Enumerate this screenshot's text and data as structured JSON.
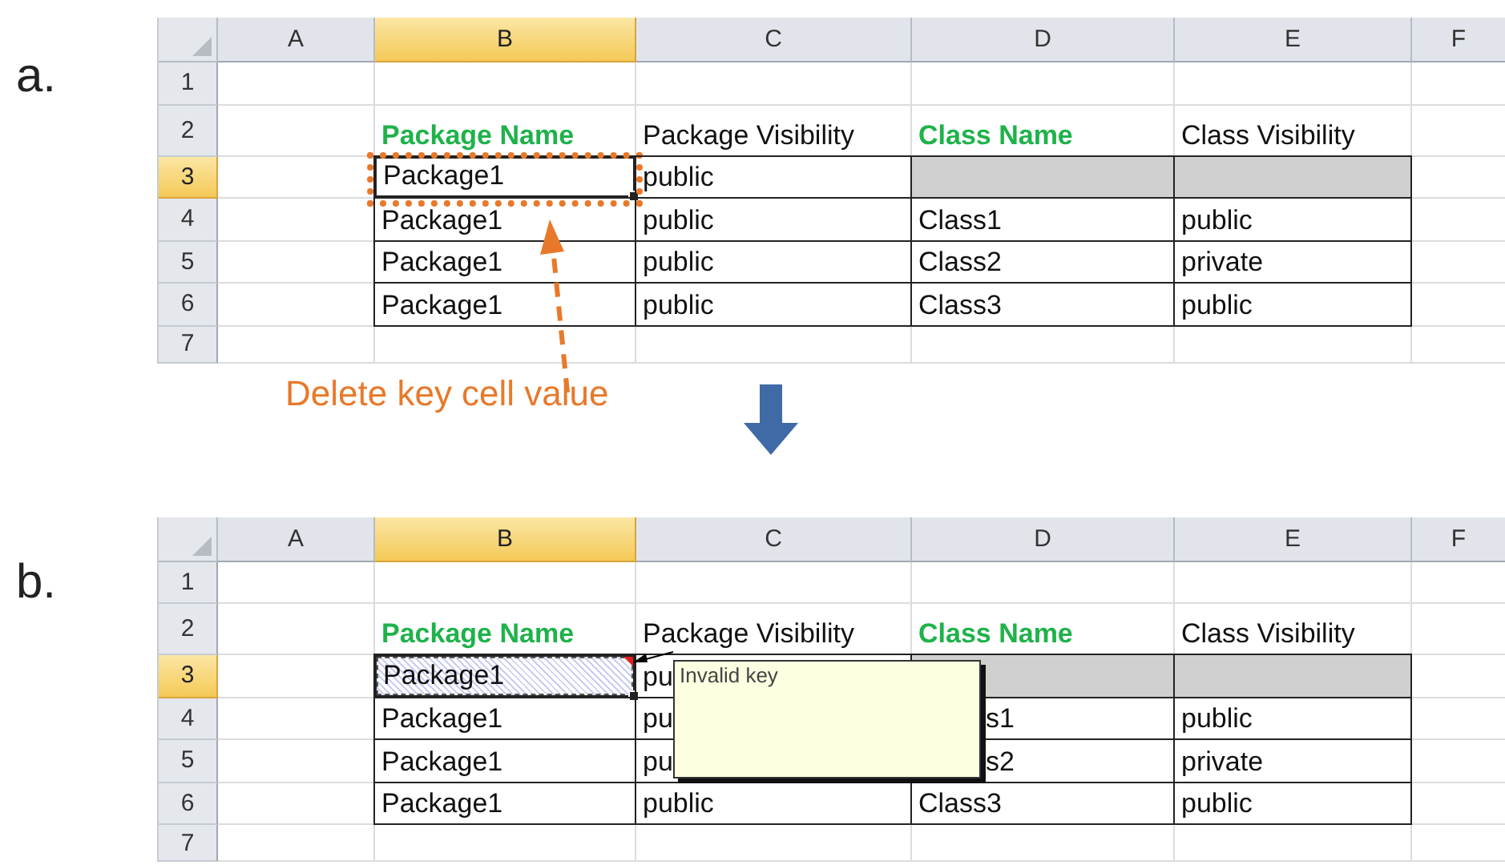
{
  "panels": [
    {
      "label": "a.",
      "columns": [
        {
          "label": "A",
          "selected": false
        },
        {
          "label": "B",
          "selected": true
        },
        {
          "label": "C",
          "selected": false
        },
        {
          "label": "D",
          "selected": false
        },
        {
          "label": "E",
          "selected": false
        },
        {
          "label": "F",
          "selected": false
        }
      ],
      "rows": [
        {
          "number": "1",
          "selected": false
        },
        {
          "number": "2",
          "selected": false,
          "cells": [
            {
              "text": "Package Name",
              "kind": "key"
            },
            {
              "text": "Package Visibility",
              "kind": "plain"
            },
            {
              "text": "Class Name",
              "kind": "key"
            },
            {
              "text": "Class Visibility",
              "kind": "plain"
            }
          ]
        },
        {
          "number": "3",
          "selected": true,
          "cells": [
            {
              "text": "Package1",
              "kind": "value",
              "selected": true,
              "annotated": true
            },
            {
              "text": "public",
              "kind": "value",
              "selected": false,
              "annotated": false
            },
            {
              "kind": "missing",
              "selected": false,
              "annotated": false
            },
            {
              "kind": "missing",
              "selected": false,
              "annotated": false
            }
          ]
        },
        {
          "number": "4",
          "selected": false,
          "cells": [
            {
              "text": "Package1",
              "kind": "value",
              "selected": false,
              "annotated": false
            },
            {
              "text": "public",
              "kind": "value",
              "selected": false,
              "annotated": false
            },
            {
              "text": "Class1",
              "kind": "value",
              "selected": false,
              "annotated": false
            },
            {
              "text": "public",
              "kind": "value",
              "selected": false,
              "annotated": false
            }
          ]
        },
        {
          "number": "5",
          "selected": false,
          "cells": [
            {
              "text": "Package1",
              "kind": "value",
              "selected": false,
              "annotated": false
            },
            {
              "text": "public",
              "kind": "value",
              "selected": false,
              "annotated": false
            },
            {
              "text": "Class2",
              "kind": "value",
              "selected": false,
              "annotated": false
            },
            {
              "text": "private",
              "kind": "value",
              "selected": false,
              "annotated": false
            }
          ]
        },
        {
          "number": "6",
          "selected": false,
          "cells": [
            {
              "text": "Package1",
              "kind": "value",
              "selected": false,
              "annotated": false
            },
            {
              "text": "public",
              "kind": "value",
              "selected": false,
              "annotated": false
            },
            {
              "text": "Class3",
              "kind": "value",
              "selected": false,
              "annotated": false
            },
            {
              "text": "public",
              "kind": "value",
              "selected": false,
              "annotated": false
            }
          ]
        },
        {
          "number": "7",
          "selected": false
        }
      ],
      "annotation": {
        "text": "Delete key cell value"
      }
    },
    {
      "label": "b.",
      "columns": [
        {
          "label": "A",
          "selected": false
        },
        {
          "label": "B",
          "selected": true
        },
        {
          "label": "C",
          "selected": false
        },
        {
          "label": "D",
          "selected": false
        },
        {
          "label": "E",
          "selected": false
        },
        {
          "label": "F",
          "selected": false
        }
      ],
      "rows": [
        {
          "number": "1",
          "selected": false
        },
        {
          "number": "2",
          "selected": false,
          "cells": [
            {
              "text": "Package Name",
              "kind": "key"
            },
            {
              "text": "Package Visibility",
              "kind": "plain"
            },
            {
              "text": "Class Name",
              "kind": "key"
            },
            {
              "text": "Class Visibility",
              "kind": "plain"
            }
          ]
        },
        {
          "number": "3",
          "selected": true,
          "cells": [
            {
              "text": "Package1",
              "kind": "value",
              "selected": true,
              "flagged": true
            },
            {
              "text": "pu",
              "kind": "value",
              "selected": false,
              "flagged": false
            },
            {
              "kind": "missing",
              "selected": false,
              "flagged": false
            },
            {
              "kind": "missing",
              "selected": false,
              "flagged": false
            }
          ]
        },
        {
          "number": "4",
          "selected": false,
          "cells": [
            {
              "text": "Package1",
              "kind": "value",
              "selected": false,
              "flagged": false
            },
            {
              "text": "pu",
              "kind": "value",
              "selected": false,
              "flagged": false
            },
            {
              "text": "s1",
              "kind": "tail",
              "selected": false,
              "flagged": false
            },
            {
              "text": "public",
              "kind": "value",
              "selected": false,
              "flagged": false
            }
          ]
        },
        {
          "number": "5",
          "selected": false,
          "cells": [
            {
              "text": "Package1",
              "kind": "value",
              "selected": false,
              "flagged": false
            },
            {
              "text": "pu",
              "kind": "value",
              "selected": false,
              "flagged": false
            },
            {
              "text": "s2",
              "kind": "tail",
              "selected": false,
              "flagged": false
            },
            {
              "text": "private",
              "kind": "value",
              "selected": false,
              "flagged": false
            }
          ]
        },
        {
          "number": "6",
          "selected": false,
          "cells": [
            {
              "text": "Package1",
              "kind": "value",
              "selected": false,
              "flagged": false
            },
            {
              "text": "public",
              "kind": "value",
              "selected": false,
              "flagged": false
            },
            {
              "text": "Class3",
              "kind": "value",
              "selected": false,
              "flagged": false
            },
            {
              "text": "public",
              "kind": "value",
              "selected": false,
              "flagged": false
            }
          ]
        },
        {
          "number": "7",
          "selected": false
        }
      ],
      "tooltip": {
        "text": "Invalid key"
      }
    }
  ]
}
